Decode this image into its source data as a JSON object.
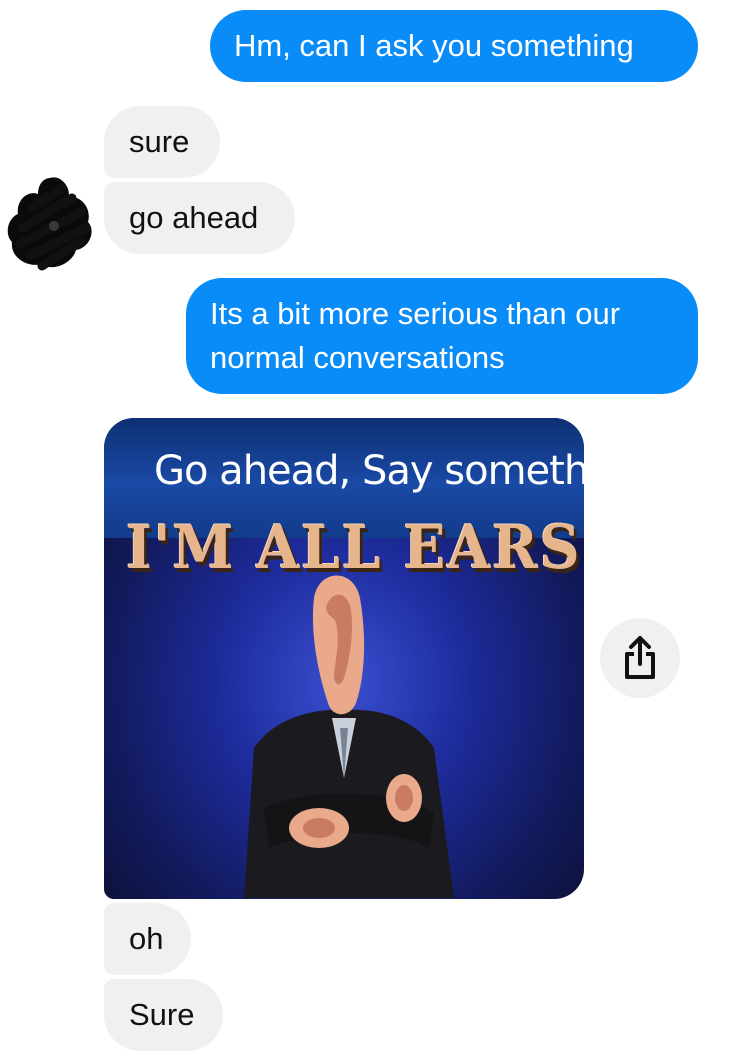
{
  "conversation": {
    "messages": [
      {
        "direction": "outgoing",
        "text": "Hm, can I ask you something"
      },
      {
        "direction": "incoming",
        "text": "sure"
      },
      {
        "direction": "incoming",
        "text": "go ahead"
      },
      {
        "direction": "outgoing",
        "text": "Its a bit more serious than our normal conversations"
      },
      {
        "direction": "incoming",
        "text": "oh"
      },
      {
        "direction": "incoming",
        "text": "Sure"
      }
    ],
    "image_message": {
      "line1": "Go ahead, Say something",
      "line2": "I'M ALL EARS"
    }
  },
  "icons": {
    "share": "share-icon",
    "avatar": "avatar"
  },
  "colors": {
    "outgoing_bubble": "#0a8cf8",
    "incoming_bubble": "#f0f0f0",
    "outgoing_text": "#ffffff",
    "incoming_text": "#111111"
  }
}
